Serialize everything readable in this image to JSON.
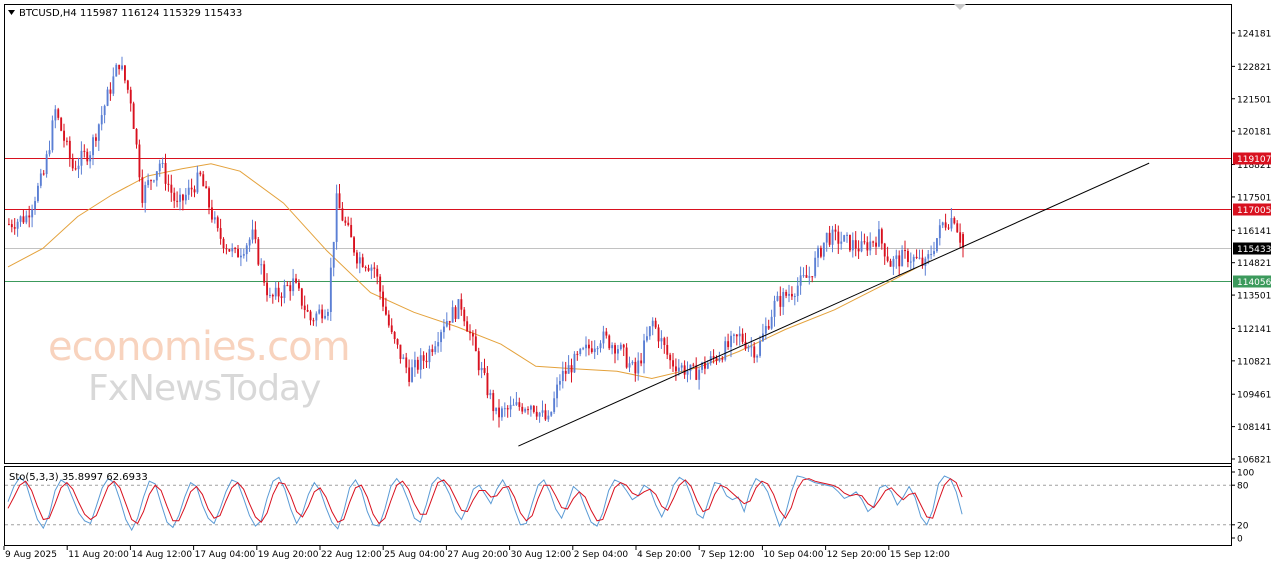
{
  "header": {
    "symbol_line": "BTCUSD,H4  115987 116124 115329 115433",
    "dropdown_icon": "triangle-down-icon"
  },
  "watermark": {
    "line1": "economies.com",
    "line2": "FxNewsToday"
  },
  "colors": {
    "bull": "#5b7fd4",
    "bear": "#d8111f",
    "ma": "#e4a23c",
    "resistance": "#d8111f",
    "support": "#3c9a5c",
    "current": "#9a9a9a",
    "trend": "#000000",
    "stoch_main": "#5b9bd5",
    "stoch_signal": "#d8111f"
  },
  "chart_data": [
    {
      "type": "candlestick",
      "symbol": "BTCUSD",
      "timeframe": "H4",
      "ohlc_header": {
        "open": 115987,
        "high": 116124,
        "low": 115329,
        "close": 115433
      },
      "ylim": [
        106821,
        124181
      ],
      "y_ticks": [
        124181,
        122821,
        121501,
        120181,
        118821,
        117501,
        116141,
        114821,
        113501,
        112141,
        110821,
        109461,
        108141,
        106821
      ],
      "x_tick_labels": [
        "9 Aug 2025",
        "11 Aug 20:00",
        "14 Aug 12:00",
        "17 Aug 04:00",
        "19 Aug 20:00",
        "22 Aug 12:00",
        "25 Aug 04:00",
        "27 Aug 20:00",
        "30 Aug 12:00",
        "2 Sep 04:00",
        "4 Sep 20:00",
        "7 Sep 12:00",
        "10 Sep 04:00",
        "12 Sep 20:00",
        "15 Sep 12:00"
      ],
      "horizontal_lines": [
        {
          "value": 119107,
          "label": "119107",
          "color": "#d8111f"
        },
        {
          "value": 117005,
          "label": "117005",
          "color": "#d8111f"
        },
        {
          "value": 115433,
          "label": "115433",
          "color": "#000000"
        },
        {
          "value": 114056,
          "label": "114056",
          "color": "#3c9a5c"
        }
      ],
      "trendline": {
        "from": {
          "bar": 176,
          "price": 107350
        },
        "to": {
          "bar": 326,
          "price": 115300
        }
      },
      "moving_average": [
        {
          "bar": 0,
          "price": 114650
        },
        {
          "bar": 12,
          "price": 115400
        },
        {
          "bar": 24,
          "price": 116700
        },
        {
          "bar": 36,
          "price": 117600
        },
        {
          "bar": 48,
          "price": 118350
        },
        {
          "bar": 60,
          "price": 118650
        },
        {
          "bar": 70,
          "price": 118850
        },
        {
          "bar": 80,
          "price": 118550
        },
        {
          "bar": 95,
          "price": 117250
        },
        {
          "bar": 110,
          "price": 115300
        },
        {
          "bar": 125,
          "price": 113600
        },
        {
          "bar": 140,
          "price": 112800
        },
        {
          "bar": 155,
          "price": 112200
        },
        {
          "bar": 170,
          "price": 111500
        },
        {
          "bar": 182,
          "price": 110600
        },
        {
          "bar": 195,
          "price": 110500
        },
        {
          "bar": 210,
          "price": 110400
        },
        {
          "bar": 222,
          "price": 110100
        },
        {
          "bar": 238,
          "price": 110550
        },
        {
          "bar": 252,
          "price": 111200
        },
        {
          "bar": 268,
          "price": 112100
        },
        {
          "bar": 285,
          "price": 112900
        },
        {
          "bar": 300,
          "price": 113800
        },
        {
          "bar": 318,
          "price": 114900
        }
      ],
      "close_path": [
        {
          "bar": 0,
          "price": 116400
        },
        {
          "bar": 6,
          "price": 116700
        },
        {
          "bar": 12,
          "price": 118400
        },
        {
          "bar": 16,
          "price": 121000
        },
        {
          "bar": 22,
          "price": 118700
        },
        {
          "bar": 28,
          "price": 119400
        },
        {
          "bar": 34,
          "price": 121600
        },
        {
          "bar": 38,
          "price": 123000
        },
        {
          "bar": 42,
          "price": 121500
        },
        {
          "bar": 46,
          "price": 117600
        },
        {
          "bar": 52,
          "price": 118900
        },
        {
          "bar": 58,
          "price": 117100
        },
        {
          "bar": 66,
          "price": 118300
        },
        {
          "bar": 72,
          "price": 116000
        },
        {
          "bar": 78,
          "price": 115100
        },
        {
          "bar": 84,
          "price": 115900
        },
        {
          "bar": 90,
          "price": 113300
        },
        {
          "bar": 98,
          "price": 114000
        },
        {
          "bar": 104,
          "price": 112500
        },
        {
          "bar": 110,
          "price": 113100
        },
        {
          "bar": 113,
          "price": 117300
        },
        {
          "bar": 120,
          "price": 115100
        },
        {
          "bar": 126,
          "price": 114600
        },
        {
          "bar": 132,
          "price": 111800
        },
        {
          "bar": 138,
          "price": 110300
        },
        {
          "bar": 144,
          "price": 111000
        },
        {
          "bar": 150,
          "price": 112400
        },
        {
          "bar": 156,
          "price": 113100
        },
        {
          "bar": 162,
          "price": 110700
        },
        {
          "bar": 168,
          "price": 108600
        },
        {
          "bar": 174,
          "price": 108900
        },
        {
          "bar": 180,
          "price": 109100
        },
        {
          "bar": 186,
          "price": 108300
        },
        {
          "bar": 190,
          "price": 110100
        },
        {
          "bar": 196,
          "price": 110900
        },
        {
          "bar": 204,
          "price": 111800
        },
        {
          "bar": 210,
          "price": 111400
        },
        {
          "bar": 216,
          "price": 110300
        },
        {
          "bar": 222,
          "price": 112400
        },
        {
          "bar": 228,
          "price": 110800
        },
        {
          "bar": 236,
          "price": 110300
        },
        {
          "bar": 244,
          "price": 111000
        },
        {
          "bar": 252,
          "price": 111800
        },
        {
          "bar": 258,
          "price": 111200
        },
        {
          "bar": 264,
          "price": 113100
        },
        {
          "bar": 270,
          "price": 113700
        },
        {
          "bar": 276,
          "price": 114300
        },
        {
          "bar": 282,
          "price": 115900
        },
        {
          "bar": 288,
          "price": 115700
        },
        {
          "bar": 294,
          "price": 115400
        },
        {
          "bar": 300,
          "price": 115900
        },
        {
          "bar": 304,
          "price": 114800
        },
        {
          "bar": 310,
          "price": 115100
        },
        {
          "bar": 316,
          "price": 114700
        },
        {
          "bar": 322,
          "price": 116400
        },
        {
          "bar": 326,
          "price": 116700
        },
        {
          "bar": 329,
          "price": 115433
        }
      ]
    },
    {
      "type": "line",
      "indicator": "Stochastic",
      "header_text": "Sto(5,3,3) 35.8997 62.6933",
      "main_value": 35.8997,
      "signal_value": 62.6933,
      "ylim": [
        0,
        100
      ],
      "y_ticks": [
        100,
        80,
        20,
        0
      ],
      "levels": [
        80,
        20
      ],
      "series": [
        {
          "name": "main",
          "color": "#5b9bd5"
        },
        {
          "name": "signal",
          "color": "#d8111f"
        }
      ],
      "values_main": [
        55,
        78,
        92,
        84,
        55,
        28,
        15,
        35,
        72,
        88,
        82,
        60,
        38,
        26,
        22,
        48,
        76,
        90,
        84,
        58,
        28,
        12,
        30,
        62,
        86,
        82,
        52,
        24,
        16,
        34,
        62,
        84,
        78,
        50,
        30,
        22,
        44,
        70,
        88,
        84,
        60,
        34,
        18,
        26,
        60,
        86,
        92,
        74,
        44,
        22,
        38,
        66,
        84,
        72,
        46,
        24,
        14,
        40,
        76,
        88,
        72,
        40,
        20,
        18,
        44,
        78,
        90,
        78,
        56,
        30,
        24,
        50,
        82,
        92,
        84,
        66,
        40,
        28,
        48,
        74,
        80,
        66,
        52,
        74,
        88,
        72,
        44,
        20,
        22,
        52,
        80,
        88,
        70,
        44,
        30,
        52,
        78,
        70,
        46,
        24,
        18,
        38,
        72,
        88,
        84,
        72,
        58,
        64,
        80,
        74,
        50,
        32,
        52,
        80,
        92,
        86,
        64,
        36,
        30,
        58,
        84,
        82,
        64,
        58,
        62,
        40,
        72,
        90,
        84,
        70,
        44,
        18,
        36,
        70,
        94,
        92,
        88,
        84,
        82,
        80,
        78,
        70,
        60,
        64,
        70,
        58,
        40,
        48,
        76,
        80,
        70,
        50,
        62,
        78,
        62,
        32,
        20,
        42,
        82,
        94,
        90,
        70,
        36
      ],
      "values_signal": [
        45,
        62,
        80,
        86,
        72,
        48,
        28,
        30,
        52,
        76,
        84,
        74,
        54,
        36,
        28,
        34,
        56,
        78,
        86,
        76,
        52,
        28,
        22,
        40,
        66,
        80,
        72,
        48,
        26,
        26,
        46,
        70,
        78,
        66,
        44,
        30,
        34,
        56,
        76,
        84,
        74,
        52,
        32,
        24,
        38,
        66,
        84,
        82,
        64,
        40,
        32,
        48,
        70,
        76,
        62,
        40,
        24,
        28,
        54,
        76,
        80,
        62,
        36,
        22,
        30,
        56,
        80,
        86,
        74,
        52,
        36,
        36,
        60,
        84,
        88,
        78,
        60,
        42,
        40,
        58,
        72,
        72,
        62,
        64,
        76,
        78,
        62,
        38,
        26,
        34,
        60,
        80,
        80,
        64,
        46,
        44,
        60,
        70,
        62,
        42,
        26,
        28,
        52,
        76,
        84,
        80,
        68,
        64,
        70,
        74,
        66,
        48,
        42,
        60,
        80,
        88,
        78,
        56,
        40,
        44,
        66,
        80,
        76,
        68,
        60,
        52,
        56,
        76,
        86,
        82,
        66,
        42,
        30,
        46,
        74,
        88,
        90,
        86,
        84,
        82,
        80,
        76,
        68,
        64,
        66,
        64,
        52,
        46,
        58,
        72,
        76,
        66,
        58,
        66,
        68,
        50,
        32,
        30,
        56,
        80,
        90,
        84,
        62
      ]
    }
  ]
}
